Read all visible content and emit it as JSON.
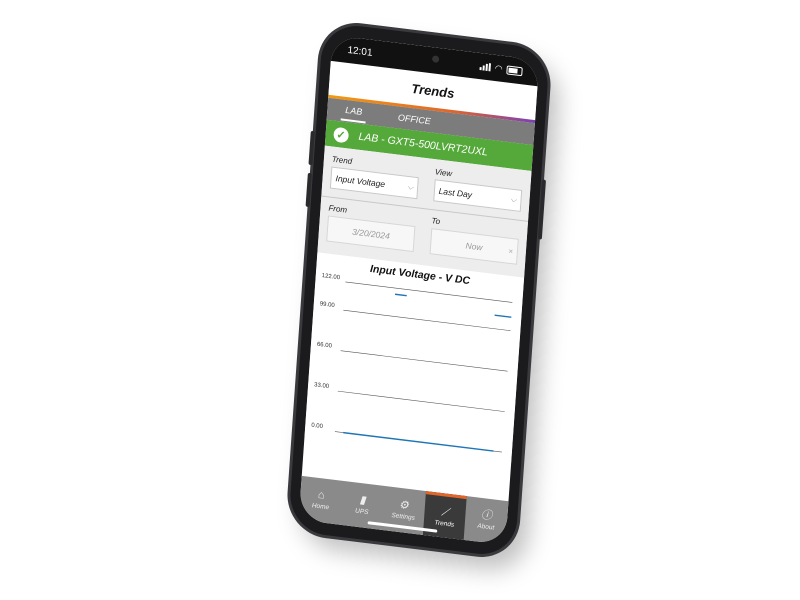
{
  "status_bar": {
    "time": "12:01"
  },
  "app": {
    "title": "Trends"
  },
  "tabs": [
    {
      "label": "LAB",
      "active": true
    },
    {
      "label": "OFFICE",
      "active": false
    }
  ],
  "device": {
    "name": "LAB - GXT5-500LVRT2UXL",
    "status_icon": "checkmark-icon"
  },
  "filters": {
    "trend_label": "Trend",
    "trend_value": "Input Voltage",
    "view_label": "View",
    "view_value": "Last Day",
    "from_label": "From",
    "from_value": "3/20/2024",
    "to_label": "To",
    "to_value": "Now",
    "to_clear": "×"
  },
  "chart_data": {
    "type": "line",
    "title": "Input Voltage - V DC",
    "ylim": [
      0,
      122
    ],
    "yticks": [
      "122.00",
      "99.00",
      "66.00",
      "33.00",
      "0.00"
    ],
    "ytick_values": [
      122,
      99,
      66,
      33,
      0
    ],
    "series": [
      {
        "segments": [
          {
            "x": [
              0.3,
              0.37
            ],
            "y": [
              117,
              117
            ]
          },
          {
            "x": [
              0.9,
              1.0
            ],
            "y": [
              110,
              110
            ]
          },
          {
            "x": [
              0.05,
              0.95
            ],
            "y": [
              0,
              0
            ]
          }
        ]
      }
    ],
    "colors": {
      "line": "#1f76b6"
    }
  },
  "bottom_nav": [
    {
      "label": "Home",
      "icon": "home-icon",
      "glyph": "⌂",
      "active": false
    },
    {
      "label": "UPS",
      "icon": "ups-icon",
      "glyph": "▮",
      "active": false
    },
    {
      "label": "Settings",
      "icon": "gear-icon",
      "glyph": "⚙",
      "active": false
    },
    {
      "label": "Trends",
      "icon": "trend-chart-icon",
      "glyph": "⟋",
      "active": true
    },
    {
      "label": "About",
      "icon": "info-icon",
      "glyph": "ⓘ",
      "active": false
    }
  ]
}
